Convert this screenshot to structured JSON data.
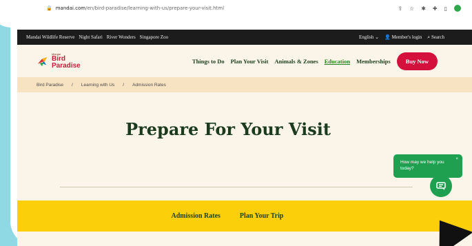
{
  "browser": {
    "url_host": "mandai.com",
    "url_path": "/en/bird-paradise/learning-with-us/prepare-your-visit.html"
  },
  "topbar": {
    "links": [
      "Mandai Wildlife Reserve",
      "Night Safari",
      "River Wonders",
      "Singapore Zoo"
    ],
    "language": "English",
    "member_login": "Member's login",
    "search": "Search"
  },
  "logo": {
    "small": "Mandai",
    "line1": "Bird",
    "line2": "Paradise"
  },
  "nav": {
    "items": [
      "Things to Do",
      "Plan Your Visit",
      "Animals & Zones",
      "Education",
      "Memberships"
    ],
    "active": "Education",
    "buy_now": "Buy Now"
  },
  "breadcrumb": {
    "items": [
      "Bird Paradise",
      "Learning with Us",
      "Admission Rates"
    ],
    "separator": "/"
  },
  "page": {
    "title": "Prepare For Your Visit"
  },
  "tabs": {
    "items": [
      "Admission Rates",
      "Plan Your Trip"
    ]
  },
  "chat": {
    "message": "How may we help you today?",
    "close": "×"
  },
  "colors": {
    "accent_red": "#d4103d",
    "accent_yellow": "#fccf0b",
    "chat_green": "#1fa050",
    "title_green": "#1b3a1e"
  }
}
